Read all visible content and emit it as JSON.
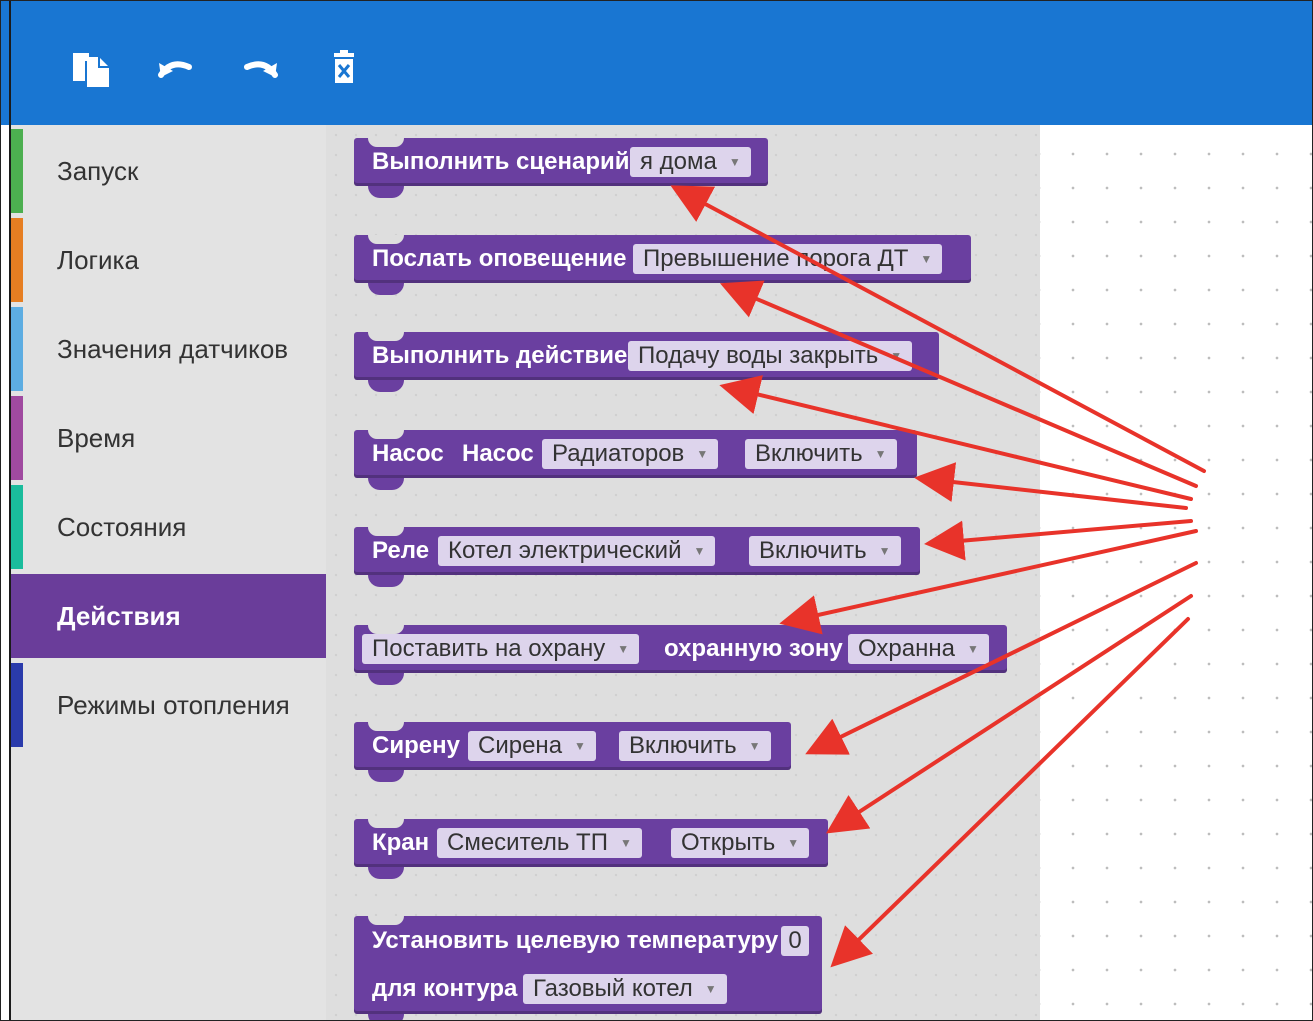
{
  "toolbar": {
    "buttons": [
      "copy-icon",
      "undo-icon",
      "redo-icon",
      "delete-icon"
    ],
    "color": "#1976d2"
  },
  "sidebar": {
    "items": [
      {
        "label": "Запуск",
        "color": "#4caf50"
      },
      {
        "label": "Логика",
        "color": "#e67e22"
      },
      {
        "label": "Значения датчиков",
        "color": "#5dade2"
      },
      {
        "label": "Время",
        "color": "#a04aa0"
      },
      {
        "label": "Состояния",
        "color": "#1abc9c"
      },
      {
        "label": "Действия",
        "color": "#6a3d9a",
        "selected": true
      },
      {
        "label": "Режимы отопления",
        "color": "#2a3bab"
      }
    ]
  },
  "blocks": {
    "run_scenario": {
      "label": "Выполнить сценарий",
      "value": "я дома"
    },
    "notify": {
      "label": "Послать оповещение",
      "value": "Превышение порога ДТ"
    },
    "run_action": {
      "label": "Выполнить действие",
      "value": "Подачу воды закрыть"
    },
    "pump": {
      "label1": "Насос",
      "label2": "Насос",
      "value": "Радиаторов",
      "state": "Включить"
    },
    "relay": {
      "label": "Реле",
      "value": "Котел электрический",
      "state": "Включить"
    },
    "arm": {
      "value": "Поставить на охрану",
      "label": "охранную зону",
      "zone": "Охранна"
    },
    "siren": {
      "label": "Сирену",
      "value": "Сирена",
      "state": "Включить"
    },
    "valve": {
      "label": "Кран",
      "value": "Смеситель ТП",
      "state": "Открыть"
    },
    "set_temp": {
      "label": "Установить целевую температуру",
      "temp": "0",
      "label2": "для контура",
      "circuit": "Газовый котел"
    }
  },
  "colors": {
    "block": "#6a3fa0",
    "arrow": "#e8332a",
    "field": "#ddd4ec"
  }
}
